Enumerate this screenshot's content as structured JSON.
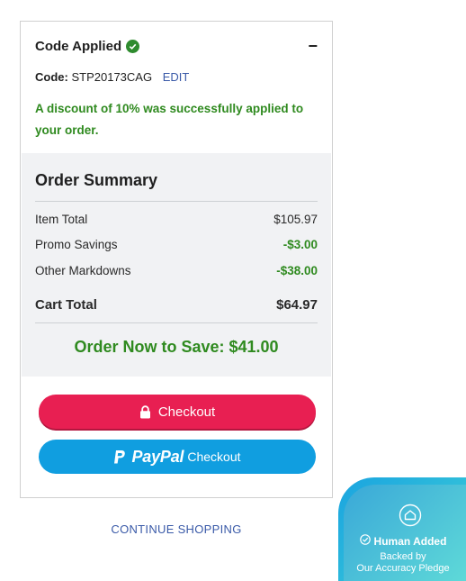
{
  "promo": {
    "title": "Code Applied",
    "collapse_symbol": "−",
    "code_label": "Code:",
    "code_value": "STP20173CAG",
    "edit_label": "EDIT",
    "message": "A discount of 10% was successfully applied to your order."
  },
  "summary": {
    "title": "Order Summary",
    "rows": [
      {
        "label": "Item Total",
        "value": "$105.97"
      },
      {
        "label": "Promo Savings",
        "value": "-$3.00"
      },
      {
        "label": "Other Markdowns",
        "value": "-$38.00"
      }
    ],
    "total_label": "Cart Total",
    "total_value": "$64.97",
    "save_message": "Order Now to Save: $41.00"
  },
  "buttons": {
    "checkout": "Checkout",
    "paypal_brand": "PayPal",
    "paypal_suffix": "Checkout"
  },
  "continue_shopping": "CONTINUE SHOPPING",
  "badge": {
    "title": "Human Added",
    "line1": "Backed by",
    "line2": "Our Accuracy Pledge"
  },
  "colors": {
    "checkout": "#e81f52",
    "paypal": "#109ee0",
    "success_green": "#2f8a1f",
    "link_blue": "#3a5aa8"
  },
  "icons": [
    "check-circle-icon",
    "lock-icon",
    "paypal-p-icon",
    "home-shield-icon",
    "check-circle-outline-icon"
  ]
}
